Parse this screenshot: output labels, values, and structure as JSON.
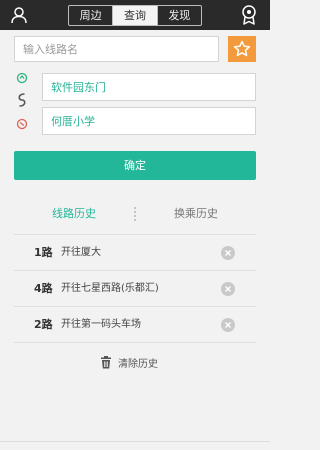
{
  "header": {
    "tabs": [
      {
        "label": "周边",
        "active": false
      },
      {
        "label": "查询",
        "active": true
      },
      {
        "label": "发现",
        "active": false
      }
    ],
    "left_icon": "user-icon",
    "right_icon": "badge-icon"
  },
  "search": {
    "placeholder": "输入线路名",
    "favorite_icon": "star-icon"
  },
  "route": {
    "from": "软件园东门",
    "to": "何厝小学",
    "icons": [
      "start-marker-icon",
      "route-path-icon",
      "end-marker-icon"
    ]
  },
  "confirm_label": "确定",
  "subtabs": {
    "route_history": "线路历史",
    "transfer_history": "换乘历史"
  },
  "history": [
    {
      "line": "1路",
      "direction": "开往厦大"
    },
    {
      "line": "4路",
      "direction": "开往七星西路(乐都汇)"
    },
    {
      "line": "2路",
      "direction": "开往第一码头车场"
    }
  ],
  "clear_label": "清除历史",
  "colors": {
    "accent": "#23b79a",
    "star": "#f39a3c",
    "topbar": "#2a2a2a"
  }
}
